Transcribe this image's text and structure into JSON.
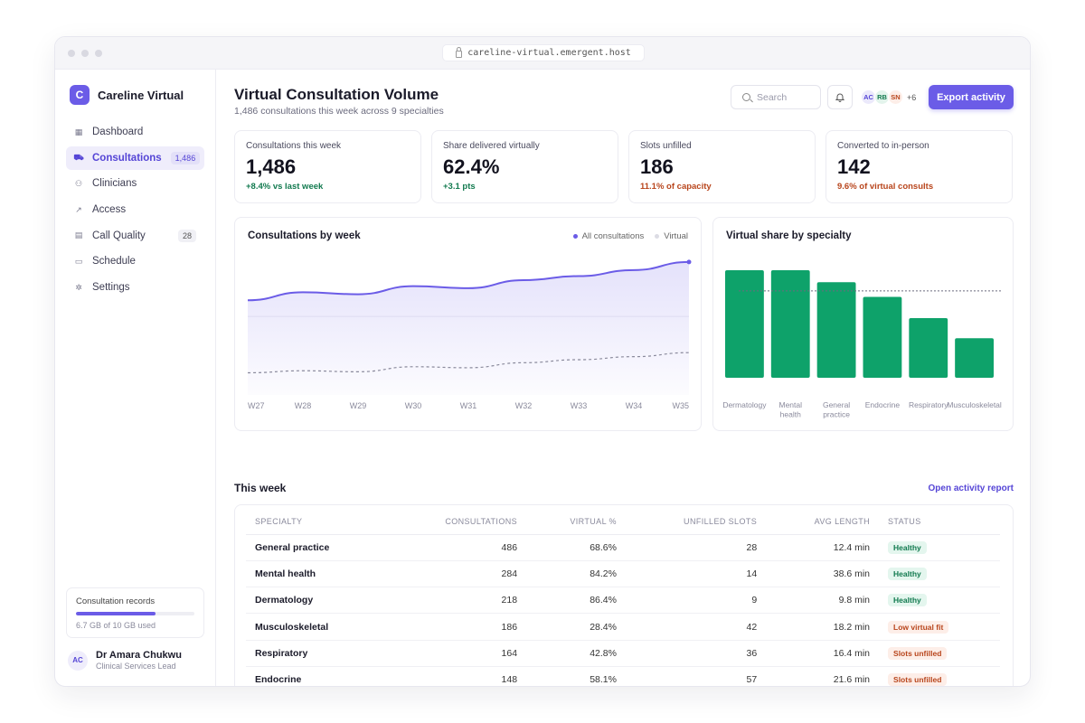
{
  "browser": {
    "url": "careline-virtual.emergent.host"
  },
  "app": {
    "logo_letter": "C",
    "name": "Careline Virtual"
  },
  "sidebar": {
    "items": [
      {
        "label": "Dashboard",
        "icon": "grid-icon",
        "badge": ""
      },
      {
        "label": "Consultations",
        "icon": "cart-icon",
        "badge": "1,486",
        "active": true
      },
      {
        "label": "Clinicians",
        "icon": "users-icon",
        "badge": ""
      },
      {
        "label": "Access",
        "icon": "trend-icon",
        "badge": ""
      },
      {
        "label": "Call Quality",
        "icon": "document-icon",
        "badge": "28"
      },
      {
        "label": "Schedule",
        "icon": "calendar-icon",
        "badge": ""
      },
      {
        "label": "Settings",
        "icon": "gear-icon",
        "badge": ""
      }
    ],
    "storage": {
      "title": "Consultation records",
      "used_text": "6.7 GB of 10 GB used",
      "fraction": 0.67
    },
    "user": {
      "initials": "AC",
      "name": "Dr Amara Chukwu",
      "role": "Clinical Services Lead"
    }
  },
  "header": {
    "title": "Virtual Consultation Volume",
    "subtitle": "1,486 consultations this week across 9 specialties",
    "search_placeholder": "Search",
    "avatars": [
      {
        "initials": "AC",
        "bg": "#ebe9fb",
        "fg": "#5545d6"
      },
      {
        "initials": "RB",
        "bg": "#e3f4ec",
        "fg": "#127a4f"
      },
      {
        "initials": "SN",
        "bg": "#fdeee8",
        "fg": "#b8451c"
      }
    ],
    "avatars_more": "+6",
    "export_label": "Export activity"
  },
  "kpis": [
    {
      "label": "Consultations this week",
      "value": "1,486",
      "delta": "+8.4% vs last week",
      "tone": "good"
    },
    {
      "label": "Share delivered virtually",
      "value": "62.4%",
      "delta": "+3.1 pts",
      "tone": "good"
    },
    {
      "label": "Slots unfilled",
      "value": "186",
      "delta": "11.1% of capacity",
      "tone": "warn"
    },
    {
      "label": "Converted to in-person",
      "value": "142",
      "delta": "9.6% of virtual consults",
      "tone": "warn"
    }
  ],
  "colors": {
    "accent": "#6b5ce7",
    "good": "#127a4f",
    "warn": "#b8451c",
    "bar": "#0ea26a"
  },
  "chart_data": [
    {
      "type": "area",
      "title": "Consultations by week",
      "categories": [
        "W27",
        "W28",
        "W29",
        "W30",
        "W31",
        "W32",
        "W33",
        "W34",
        "W35"
      ],
      "series": [
        {
          "name": "All consultations",
          "values": [
            1270,
            1310,
            1300,
            1340,
            1330,
            1370,
            1390,
            1420,
            1460
          ]
        },
        {
          "name": "Virtual",
          "values": [
            910,
            920,
            915,
            940,
            935,
            960,
            975,
            990,
            1010
          ]
        }
      ],
      "ylim": [
        800,
        1500
      ],
      "legend": "top-right"
    },
    {
      "type": "bar",
      "title": "Virtual share by specialty",
      "categories": [
        "Dermatology",
        "Mental health",
        "General practice",
        "Endocrine",
        "Respiratory",
        "Musculoskeletal"
      ],
      "values": [
        86.4,
        84.2,
        68.6,
        58.1,
        42.8,
        28.4
      ],
      "reference_line": 62.4,
      "ylim": [
        0,
        100
      ]
    }
  ],
  "table": {
    "title": "This week",
    "link": "Open activity report",
    "columns": [
      "SPECIALTY",
      "CONSULTATIONS",
      "VIRTUAL %",
      "UNFILLED SLOTS",
      "AVG LENGTH",
      "STATUS"
    ],
    "rows": [
      {
        "specialty": "General practice",
        "consultations": "486",
        "virtual": "68.6%",
        "unfilled": "28",
        "avg": "12.4 min",
        "status": "Healthy",
        "tone": "good"
      },
      {
        "specialty": "Mental health",
        "consultations": "284",
        "virtual": "84.2%",
        "unfilled": "14",
        "avg": "38.6 min",
        "status": "Healthy",
        "tone": "good"
      },
      {
        "specialty": "Dermatology",
        "consultations": "218",
        "virtual": "86.4%",
        "unfilled": "9",
        "avg": "9.8 min",
        "status": "Healthy",
        "tone": "good"
      },
      {
        "specialty": "Musculoskeletal",
        "consultations": "186",
        "virtual": "28.4%",
        "unfilled": "42",
        "avg": "18.2 min",
        "status": "Low virtual fit",
        "tone": "warn"
      },
      {
        "specialty": "Respiratory",
        "consultations": "164",
        "virtual": "42.8%",
        "unfilled": "36",
        "avg": "16.4 min",
        "status": "Slots unfilled",
        "tone": "warn"
      },
      {
        "specialty": "Endocrine",
        "consultations": "148",
        "virtual": "58.1%",
        "unfilled": "57",
        "avg": "21.6 min",
        "status": "Slots unfilled",
        "tone": "warn"
      }
    ]
  }
}
